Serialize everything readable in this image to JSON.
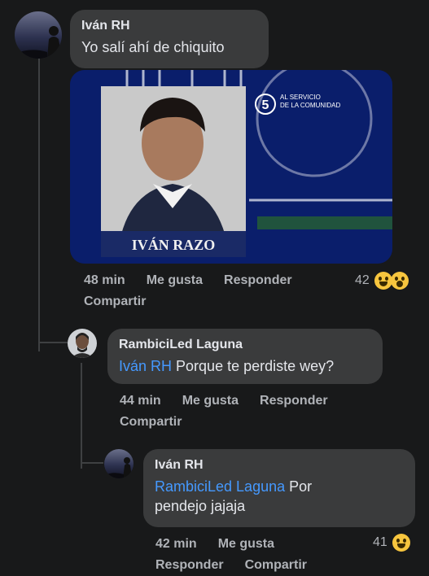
{
  "comments": [
    {
      "author": "Iván RH",
      "text": "Yo salí ahí de chiquito",
      "photo_caption": "IVÁN RAZO",
      "photo_logo_line1": "AL SERVICIO",
      "photo_logo_line2": "DE LA COMUNIDAD",
      "photo_channel": "5",
      "time": "48 min",
      "like": "Me gusta",
      "reply": "Responder",
      "share": "Compartir",
      "reaction_count": "42",
      "reaction_icons": [
        "laughing-icon",
        "wow-icon"
      ]
    },
    {
      "author": "RambiciLed Laguna",
      "mention": "Iván RH",
      "text": " Porque te perdiste wey?",
      "time": "44 min",
      "like": "Me gusta",
      "reply": "Responder",
      "share": "Compartir"
    },
    {
      "author": "Iván RH",
      "mention": "RambiciLed Laguna",
      "text_line1_rest": " Por",
      "text_line2": "pendejo jajaja",
      "time": "42 min",
      "like": "Me gusta",
      "reply": "Responder",
      "share": "Compartir",
      "reaction_count": "41",
      "reaction_icons": [
        "laughing-icon"
      ]
    }
  ],
  "colors": {
    "background": "#18191a",
    "bubble": "#3a3b3c",
    "mention": "#4599ff",
    "meta": "#b0b3b8"
  }
}
